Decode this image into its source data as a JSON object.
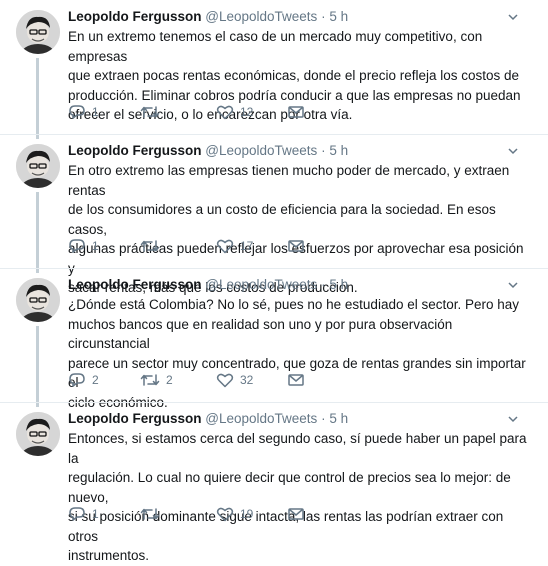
{
  "tweets": [
    {
      "author": "Leopoldo Fergusson",
      "handle": "@LeopoldoTweets",
      "dot": "·",
      "time": "5 h",
      "lines": [
        "En un extremo tenemos el caso de un mercado muy competitivo, con empresas",
        "que extraen pocas rentas económicas, donde el precio refleja los costos de",
        "producción. Eliminar cobros podría conducir a que las empresas no puedan",
        "ofrecer el servicio, o lo encarezcan por otra vía."
      ],
      "replies": "1",
      "retweets": "",
      "likes": "12"
    },
    {
      "author": "Leopoldo Fergusson",
      "handle": "@LeopoldoTweets",
      "dot": "·",
      "time": "5 h",
      "lines": [
        "En otro extremo las empresas tienen mucho poder de mercado, y extraen rentas",
        "de los consumidores a un costo de eficiencia para la sociedad. En esos casos,",
        "algunas prácticas pueden reflejar los esfuerzos por aprovechar esa posición y",
        "sacar rentas, más que los costos de producción."
      ],
      "replies": "1",
      "retweets": "",
      "likes": "17"
    },
    {
      "author": "Leopoldo Fergusson",
      "handle": "@LeopoldoTweets",
      "dot": "·",
      "time": "5 h",
      "lines": [
        "¿Dónde está Colombia? No lo sé, pues no he estudiado el sector. Pero hay",
        "muchos bancos que en realidad son uno y por pura observación circunstancial",
        "parece un sector muy concentrado, que goza de rentas grandes sin importar el",
        "ciclo económico."
      ],
      "replies": "2",
      "retweets": "2",
      "likes": "32"
    },
    {
      "author": "Leopoldo Fergusson",
      "handle": "@LeopoldoTweets",
      "dot": "·",
      "time": "5 h",
      "lines": [
        "Entonces, si estamos cerca del segundo caso, sí puede haber un papel para la",
        "regulación. Lo cual no quiere decir que control de precios sea lo mejor: de nuevo,",
        "si su posición dominante sigue intacta, las rentas las podrían extraer con otros",
        "instrumentos."
      ],
      "replies": "1",
      "retweets": "",
      "likes": "19"
    }
  ],
  "icons": {
    "reply": "reply-icon",
    "retweet": "retweet-icon",
    "like": "heart-icon",
    "dm": "envelope-icon",
    "caret": "chevron-down-icon"
  },
  "colors": {
    "icon": "#657786",
    "thread_line": "#c4cfd6",
    "divider": "#e6ecf0"
  }
}
